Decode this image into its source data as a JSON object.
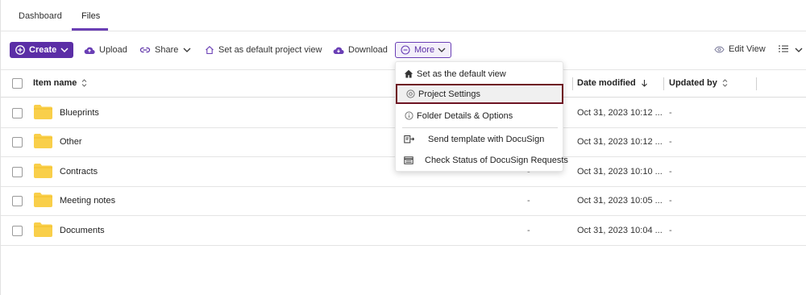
{
  "tabs": [
    {
      "label": "Dashboard"
    },
    {
      "label": "Files"
    }
  ],
  "toolbar": {
    "create": "Create",
    "upload": "Upload",
    "share": "Share",
    "set_default": "Set as default project view",
    "download": "Download",
    "more": "More",
    "edit_view": "Edit View"
  },
  "table": {
    "columns": {
      "item_name": "Item name",
      "date_modified": "Date modified",
      "updated_by": "Updated by"
    },
    "rows": [
      {
        "name": "Blueprints",
        "dash1": "",
        "date": "Oct 31, 2023 10:12 ...",
        "updated_by": "-"
      },
      {
        "name": "Other",
        "dash1": "",
        "date": "Oct 31, 2023 10:12 ...",
        "updated_by": "-"
      },
      {
        "name": "Contracts",
        "dash1": "-",
        "date": "Oct 31, 2023 10:10 ...",
        "updated_by": "-"
      },
      {
        "name": "Meeting notes",
        "dash1": "-",
        "date": "Oct 31, 2023 10:05 ...",
        "updated_by": "-"
      },
      {
        "name": "Documents",
        "dash1": "-",
        "date": "Oct 31, 2023 10:04 ...",
        "updated_by": "-"
      }
    ]
  },
  "more_menu": {
    "items": [
      {
        "label": "Set as the default view",
        "icon": "home-icon"
      },
      {
        "label": "Project Settings",
        "icon": "gear-icon",
        "selected": true
      },
      {
        "label": "Folder Details & Options",
        "icon": "info-icon"
      },
      {
        "label": "Send template with DocuSign",
        "icon": "send-template-icon"
      },
      {
        "label": "Check Status of DocuSign Requests",
        "icon": "status-list-icon"
      }
    ]
  },
  "colors": {
    "accent": "#5b2ea6",
    "selected_border": "#6e1423",
    "folder": "#f9cf4a"
  }
}
